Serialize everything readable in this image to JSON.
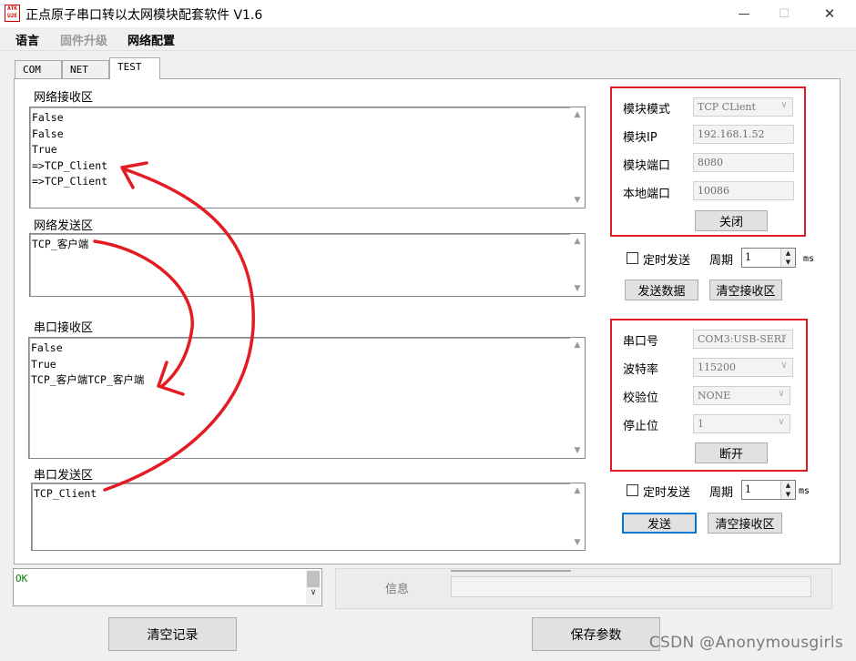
{
  "window": {
    "logo_text": "ATK\nU2E",
    "title": "正点原子串口转以太网模块配套软件 V1.6",
    "minimize_glyph": "—",
    "maximize_glyph": "☐",
    "close_glyph": "✕"
  },
  "menu": [
    "语言",
    "固件升级",
    "网络配置"
  ],
  "tabs": [
    "COM",
    "NET",
    "TEST"
  ],
  "net_receive": {
    "label": "网络接收区",
    "text": "False\nFalse\nTrue\n=>TCP_Client\n=>TCP_Client"
  },
  "net_send": {
    "label": "网络发送区",
    "text": "TCP_客户端"
  },
  "serial_receive": {
    "label": "串口接收区",
    "text": "False\nTrue\nTCP_客户端TCP_客户端"
  },
  "serial_send": {
    "label": "串口发送区",
    "text": "TCP_Client"
  },
  "module_config": {
    "mode_label": "模块模式",
    "mode_value": "TCP CLient",
    "ip_label": "模块IP",
    "ip_value": "192.168.1.52",
    "port_label": "模块端口",
    "port_value": "8080",
    "local_port_label": "本地端口",
    "local_port_value": "10086",
    "close_button": "关闭"
  },
  "net_timer": {
    "timed_send_label": "定时发送",
    "period_label": "周期",
    "period_value": "1",
    "unit": "ms",
    "send_button": "发送数据",
    "clear_button": "清空接收区"
  },
  "serial_config": {
    "port_label": "串口号",
    "port_value": "COM3:USB-SERI",
    "baud_label": "波特率",
    "baud_value": "115200",
    "parity_label": "校验位",
    "parity_value": "NONE",
    "stop_label": "停止位",
    "stop_value": "1",
    "disconnect_button": "断开"
  },
  "serial_timer": {
    "timed_send_label": "定时发送",
    "period_label": "周期",
    "period_value": "1",
    "unit": "ms",
    "send_button": "发送",
    "clear_button": "清空接收区"
  },
  "log": {
    "text": "OK"
  },
  "info_label": "信息",
  "bottom": {
    "clear_log_button": "清空记录",
    "save_params_button": "保存参数"
  },
  "watermark": "CSDN @Anonymousgirls",
  "colors": {
    "annotation_red": "#e31b23",
    "focus_blue": "#0078d7",
    "log_green": "#008000"
  }
}
